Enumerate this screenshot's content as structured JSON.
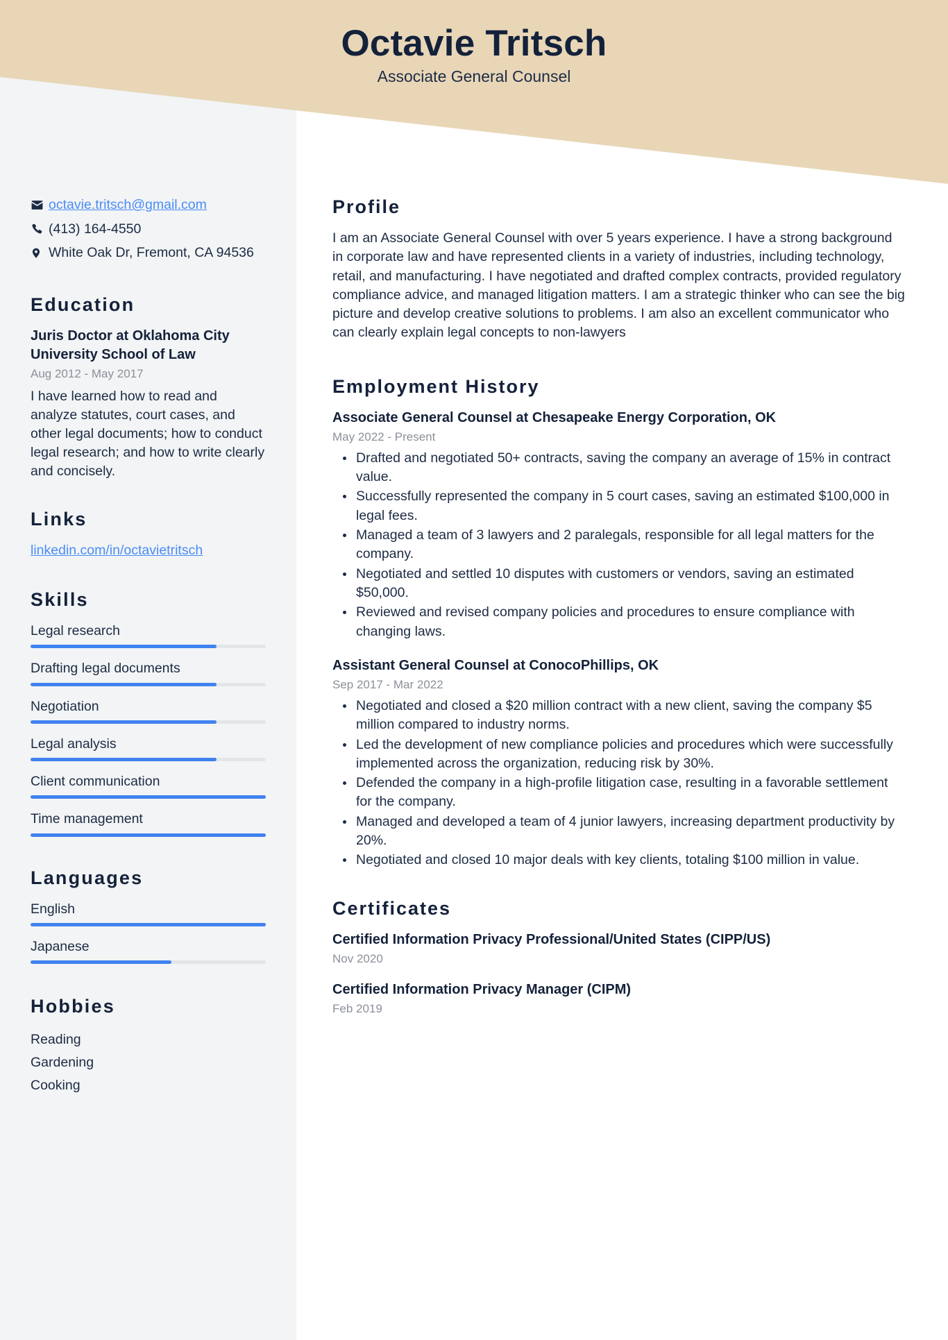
{
  "header": {
    "name": "Octavie Tritsch",
    "role": "Associate General Counsel",
    "band_color": "#e8d6b7"
  },
  "theme": {
    "accent": "#3f82ef",
    "link": "#4a8cf7",
    "heading": "#14213a",
    "muted": "#8b9099",
    "sidebar_bg": "#f2f4f5"
  },
  "sidebar": {
    "contact": [
      {
        "icon": "envelope-icon",
        "value": "octavie.tritsch@gmail.com",
        "is_link": true
      },
      {
        "icon": "phone-icon",
        "value": "(413) 164-4550",
        "is_link": false
      },
      {
        "icon": "location-pin-icon",
        "value": "White Oak Dr, Fremont, CA 94536",
        "is_link": false
      }
    ],
    "education": {
      "heading": "Education",
      "items": [
        {
          "title": "Juris Doctor at Oklahoma City University School of Law",
          "date": "Aug 2012 - May 2017",
          "description": "I have learned how to read and analyze statutes, court cases, and other legal documents; how to conduct legal research; and how to write clearly and concisely."
        }
      ]
    },
    "links": {
      "heading": "Links",
      "items": [
        {
          "label": "linkedin.com/in/octavietritsch"
        }
      ]
    },
    "skills": {
      "heading": "Skills",
      "items": [
        {
          "label": "Legal research",
          "level": 79
        },
        {
          "label": "Drafting legal documents",
          "level": 79
        },
        {
          "label": "Negotiation",
          "level": 79
        },
        {
          "label": "Legal analysis",
          "level": 79
        },
        {
          "label": "Client communication",
          "level": 100
        },
        {
          "label": "Time management",
          "level": 100
        }
      ]
    },
    "languages": {
      "heading": "Languages",
      "items": [
        {
          "label": "English",
          "level": 100
        },
        {
          "label": "Japanese",
          "level": 60
        }
      ]
    },
    "hobbies": {
      "heading": "Hobbies",
      "items": [
        {
          "label": "Reading"
        },
        {
          "label": "Gardening"
        },
        {
          "label": "Cooking"
        }
      ]
    }
  },
  "main": {
    "profile": {
      "heading": "Profile",
      "text": "I am an Associate General Counsel with over 5 years experience. I have a strong background in corporate law and have represented clients in a variety of industries, including technology, retail, and manufacturing. I have negotiated and drafted complex contracts, provided regulatory compliance advice, and managed litigation matters. I am a strategic thinker who can see the big picture and develop creative solutions to problems. I am also an excellent communicator who can clearly explain legal concepts to non-lawyers"
    },
    "employment": {
      "heading": "Employment History",
      "jobs": [
        {
          "title": "Associate General Counsel at Chesapeake Energy Corporation, OK",
          "date": "May 2022 - Present",
          "bullets": [
            "Drafted and negotiated 50+ contracts, saving the company an average of 15% in contract value.",
            "Successfully represented the company in 5 court cases, saving an estimated $100,000 in legal fees.",
            "Managed a team of 3 lawyers and 2 paralegals, responsible for all legal matters for the company.",
            "Negotiated and settled 10 disputes with customers or vendors, saving an estimated $50,000.",
            "Reviewed and revised company policies and procedures to ensure compliance with changing laws."
          ]
        },
        {
          "title": "Assistant General Counsel at ConocoPhillips, OK",
          "date": "Sep 2017 - Mar 2022",
          "bullets": [
            "Negotiated and closed a $20 million contract with a new client, saving the company $5 million compared to industry norms.",
            "Led the development of new compliance policies and procedures which were successfully implemented across the organization, reducing risk by 30%.",
            "Defended the company in a high-profile litigation case, resulting in a favorable settlement for the company.",
            "Managed and developed a team of 4 junior lawyers, increasing department productivity by 20%.",
            "Negotiated and closed 10 major deals with key clients, totaling $100 million in value."
          ]
        }
      ]
    },
    "certificates": {
      "heading": "Certificates",
      "items": [
        {
          "title": "Certified Information Privacy Professional/United States (CIPP/US)",
          "date": "Nov 2020"
        },
        {
          "title": "Certified Information Privacy Manager (CIPM)",
          "date": "Feb 2019"
        }
      ]
    }
  }
}
